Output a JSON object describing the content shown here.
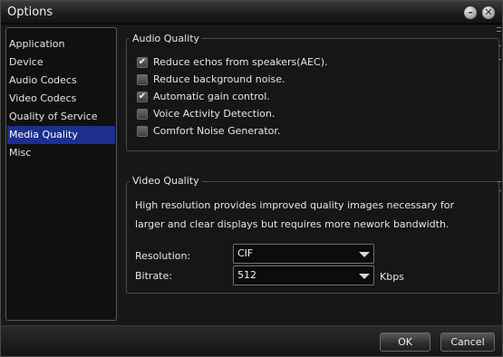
{
  "window": {
    "title": "Options",
    "minimize_icon": "minimize-icon",
    "close_icon": "close-icon"
  },
  "sidebar": {
    "items": [
      {
        "label": "Application",
        "selected": false
      },
      {
        "label": "Device",
        "selected": false
      },
      {
        "label": "Audio Codecs",
        "selected": false
      },
      {
        "label": "Video Codecs",
        "selected": false
      },
      {
        "label": "Quality of Service",
        "selected": false
      },
      {
        "label": "Media Quality",
        "selected": true
      },
      {
        "label": "Misc",
        "selected": false
      }
    ]
  },
  "audio_quality": {
    "title": "Audio Quality",
    "options": [
      {
        "label": "Reduce echos from speakers(AEC).",
        "checked": true
      },
      {
        "label": "Reduce background noise.",
        "checked": false
      },
      {
        "label": "Automatic gain control.",
        "checked": true
      },
      {
        "label": "Voice Activity Detection.",
        "checked": false
      },
      {
        "label": "Comfort Noise Generator.",
        "checked": false
      }
    ]
  },
  "video_quality": {
    "title": "Video Quality",
    "description_line1": "High resolution provides improved quality images necessary for",
    "description_line2": "larger and clear displays but requires more nework bandwidth.",
    "resolution_label": "Resolution:",
    "resolution_value": "CIF",
    "bitrate_label": "Bitrate:",
    "bitrate_value": "512",
    "bitrate_unit": "Kbps"
  },
  "buttons": {
    "ok": "OK",
    "cancel": "Cancel"
  },
  "colors": {
    "selection": "#1c2f8f",
    "background": "#181818"
  }
}
